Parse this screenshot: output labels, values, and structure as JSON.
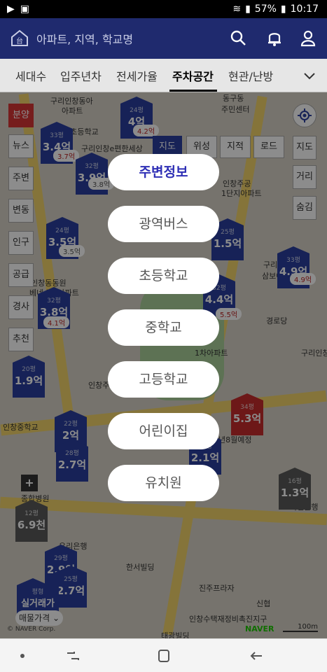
{
  "statusbar": {
    "battery": "57%",
    "time": "10:17"
  },
  "search": {
    "placeholder": "아파트, 지역, 학교명"
  },
  "tabs": [
    {
      "label": "세대수"
    },
    {
      "label": "입주년차"
    },
    {
      "label": "전세가율"
    },
    {
      "label": "주차공간"
    },
    {
      "label": "현관/난방"
    }
  ],
  "left_buttons": [
    "분양",
    "뉴스",
    "주변",
    "변동",
    "인구",
    "공급",
    "경사",
    "추천"
  ],
  "right_buttons": [
    "지도",
    "거리",
    "숨김"
  ],
  "map_types": [
    "지도",
    "위성",
    "지적",
    "로드"
  ],
  "menu": [
    "주변정보",
    "광역버스",
    "초등학교",
    "중학교",
    "고등학교",
    "어린이집",
    "유치원"
  ],
  "markers": [
    {
      "size": "24평",
      "price": "4억",
      "tag": "4.2억"
    },
    {
      "size": "33평",
      "price": "3.4억",
      "tag": "3.7억"
    },
    {
      "size": "32평",
      "price": "3.9억",
      "tag": "3.8억"
    },
    {
      "size": "24평",
      "price": "3.5억",
      "tag": "3.5억"
    },
    {
      "size": "32평",
      "price": "3.8억",
      "tag": "4.1억"
    },
    {
      "size": "20평",
      "price": "1.9억"
    },
    {
      "size": "25평",
      "price": "1.5억"
    },
    {
      "size": "33평",
      "price": "4.9억",
      "tag": "4.9억"
    },
    {
      "size": "32평",
      "price": "4.4억",
      "tag": "5.5억"
    },
    {
      "size": "34평",
      "price": "5.3억"
    },
    {
      "size": "22평",
      "price": "2억"
    },
    {
      "size": "28평",
      "price": "2.7억"
    },
    {
      "size": "24평",
      "price": "2.1억"
    },
    {
      "size": "16평",
      "price": "1.3억"
    },
    {
      "size": "12평",
      "price": "6.9천"
    },
    {
      "size": "29평",
      "price": "2.9억"
    },
    {
      "size": "25평",
      "price": "2.7억"
    },
    {
      "size": "평형",
      "price": "실거래가"
    }
  ],
  "map_labels": [
    "구리인창동아",
    "아파트",
    "구리인창e편한세상",
    "인창초등학교",
    "동구동",
    "주민센터",
    "인창주공",
    "1단지아파트",
    "인창동동원",
    "베네스트아파트",
    "구리인창",
    "삼보아파트",
    "경로당",
    "1차아파트",
    "인창주민센터",
    "구리인창",
    "2020년8월예정",
    "인창중학교",
    "종합병원",
    "우리은행",
    "한서빌딩",
    "진주프라자",
    "신협",
    "국민은행",
    "인창수택재정비촉진지구",
    "태광빌딩"
  ],
  "legend": "매물가격",
  "naver": "NAVER",
  "scale": "100m",
  "copyright": "© NAVER Corp."
}
